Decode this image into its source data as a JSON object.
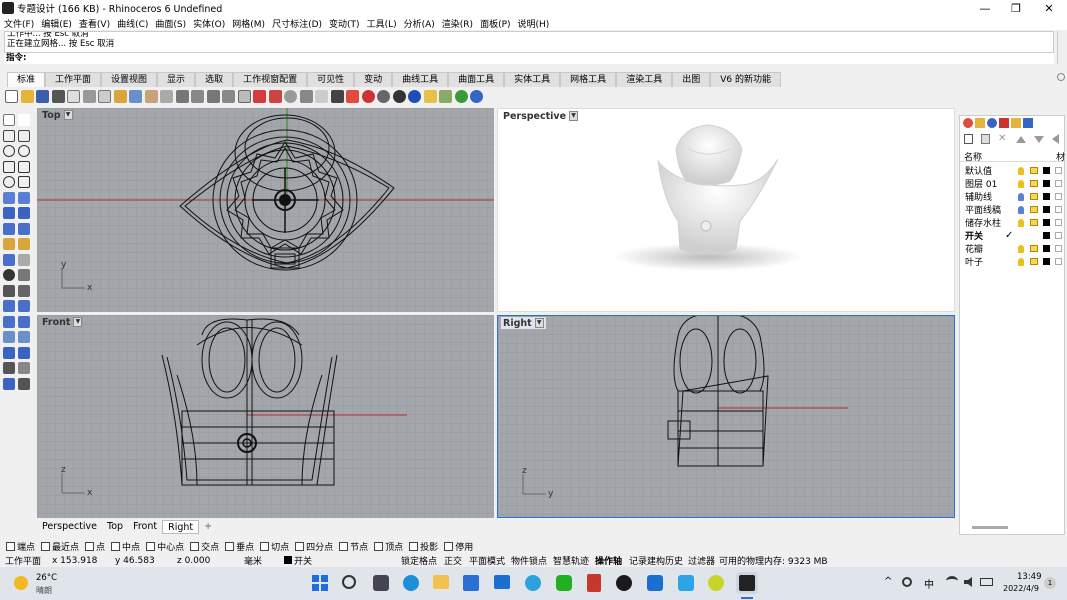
{
  "window": {
    "title": "专题设计 (166 KB) - Rhinoceros 6 Undefined",
    "minimize": "—",
    "maximize": "❐",
    "close": "✕"
  },
  "menu": [
    "文件(F)",
    "编辑(E)",
    "查看(V)",
    "曲线(C)",
    "曲面(S)",
    "实体(O)",
    "网格(M)",
    "尺寸标注(D)",
    "变动(T)",
    "工具(L)",
    "分析(A)",
    "渲染(R)",
    "面板(P)",
    "说明(H)"
  ],
  "command": {
    "history_line1": "工作中... 按 Esc 取消",
    "history_line2": "正在建立网格... 按 Esc 取消",
    "prompt": "指令:"
  },
  "tabs": [
    "标准",
    "工作平面",
    "设置视图",
    "显示",
    "选取",
    "工作视窗配置",
    "可见性",
    "变动",
    "曲线工具",
    "曲面工具",
    "实体工具",
    "网格工具",
    "渲染工具",
    "出图",
    "V6 的新功能"
  ],
  "active_tab": "标准",
  "viewports": {
    "top": {
      "label": "Top"
    },
    "perspective": {
      "label": "Perspective"
    },
    "front": {
      "label": "Front"
    },
    "right": {
      "label": "Right"
    }
  },
  "axis_labels": {
    "x": "x",
    "y": "y",
    "z": "z"
  },
  "viewport_tabs": [
    "Perspective",
    "Top",
    "Front",
    "Right",
    "+"
  ],
  "active_viewport_tab": "Right",
  "layers_panel": {
    "col_name": "名称",
    "col_mat": "材",
    "rows": [
      {
        "name": "默认值",
        "bulb": "#e8c11c"
      },
      {
        "name": "图层 01",
        "bulb": "#e8c11c"
      },
      {
        "name": "辅助线",
        "bulb": "#5a7fd6"
      },
      {
        "name": "平面线稿",
        "bulb": "#5a7fd6"
      },
      {
        "name": "储存水柱",
        "bulb": "#e8c11c"
      },
      {
        "name": "开关",
        "bold": true,
        "current": "✓"
      },
      {
        "name": "花瓣",
        "bulb": "#e8c11c"
      },
      {
        "name": "叶子",
        "bulb": "#e8c11c"
      }
    ]
  },
  "osnaps": [
    "端点",
    "最近点",
    "点",
    "中点",
    "中心点",
    "交点",
    "垂点",
    "切点",
    "四分点",
    "节点",
    "顶点",
    "投影"
  ],
  "osnap_disable": "停用",
  "status": {
    "cplane": "工作平面",
    "x": "x 153.918",
    "y": "y 46.583",
    "z": "z 0.000",
    "units": "毫米",
    "layer": "开关",
    "grid_snap": "锁定格点",
    "ortho": "正交",
    "planar": "平面模式",
    "osnap": "物件锁点",
    "smarttrack": "智慧轨迹",
    "gumball": "操作轴",
    "history": "记录建构历史",
    "filter": "过滤器",
    "memory": "可用的物理内存: 9323 MB"
  },
  "taskbar": {
    "temp": "26°C",
    "weather": "晴朗",
    "ime": "中",
    "time": "13:49",
    "date": "2022/4/9",
    "notif": "1"
  },
  "colors": {
    "viewport_bg": "#a3a6aa",
    "perspective_bg": "#ffffff",
    "accent": "#2a6fd6"
  }
}
